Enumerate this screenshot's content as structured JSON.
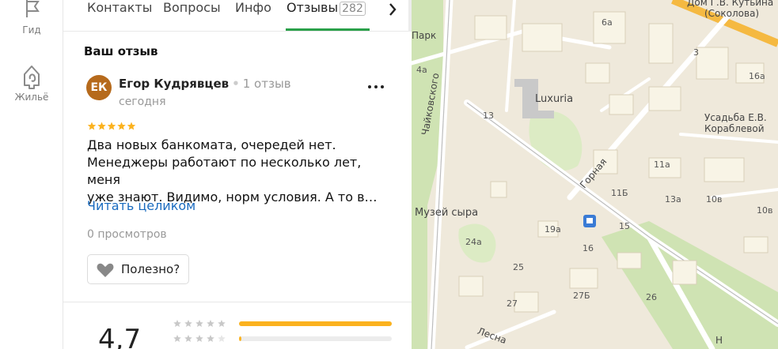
{
  "rail": {
    "items": [
      {
        "label": "Гид",
        "icon": "flag-icon"
      },
      {
        "label": "Жильё",
        "icon": "house-icon"
      }
    ]
  },
  "tabs": {
    "items": [
      {
        "label": "Контакты"
      },
      {
        "label": "Вопросы"
      },
      {
        "label": "Инфо"
      },
      {
        "label": "Отзывы",
        "count": "282",
        "active": true
      }
    ]
  },
  "review": {
    "section_title": "Ваш отзыв",
    "avatar_initials": "ЕК",
    "author": "Егор Кудрявцев",
    "author_reviews": "1 отзыв",
    "date": "сегодня",
    "stars": 5,
    "text_lines": [
      "Два новых банкомата, очередей нет.",
      "Менеджеры работают по несколько лет, меня",
      "уже знают. Видимо, норм условия. А то в…"
    ],
    "read_more": "Читать целиком",
    "views": "0 просмотров",
    "useful_label": "Полезно?"
  },
  "rating": {
    "value": "4,7",
    "bars": [
      {
        "stars": 5,
        "fraction": 1.0
      },
      {
        "stars": 4,
        "fraction": 0.01
      }
    ]
  },
  "map": {
    "labels": [
      {
        "text": "Дом Г.В. Кутьина",
        "cls": "big"
      },
      {
        "text": "(Соколова)",
        "cls": "big"
      },
      {
        "text": "6а",
        "cls": ""
      },
      {
        "text": "3",
        "cls": ""
      },
      {
        "text": "16а",
        "cls": ""
      },
      {
        "text": "Парк",
        "cls": "big"
      },
      {
        "text": "4а",
        "cls": ""
      },
      {
        "text": "Чайковского",
        "cls": "big"
      },
      {
        "text": "Luxuria",
        "cls": "poi"
      },
      {
        "text": "13",
        "cls": ""
      },
      {
        "text": "Усадьба Е.В.",
        "cls": "big"
      },
      {
        "text": "Кораблевой",
        "cls": "big"
      },
      {
        "text": "Горная",
        "cls": "big"
      },
      {
        "text": "11а",
        "cls": ""
      },
      {
        "text": "11Б",
        "cls": ""
      },
      {
        "text": "13а",
        "cls": ""
      },
      {
        "text": "10в",
        "cls": ""
      },
      {
        "text": "10в",
        "cls": ""
      },
      {
        "text": "Музей сыра",
        "cls": "poi"
      },
      {
        "text": "19а",
        "cls": ""
      },
      {
        "text": "15",
        "cls": ""
      },
      {
        "text": "24а",
        "cls": ""
      },
      {
        "text": "16",
        "cls": ""
      },
      {
        "text": "25",
        "cls": ""
      },
      {
        "text": "27Б",
        "cls": ""
      },
      {
        "text": "27",
        "cls": ""
      },
      {
        "text": "26",
        "cls": ""
      },
      {
        "text": "Лесна",
        "cls": "big"
      },
      {
        "text": "Н",
        "cls": "big"
      }
    ]
  }
}
